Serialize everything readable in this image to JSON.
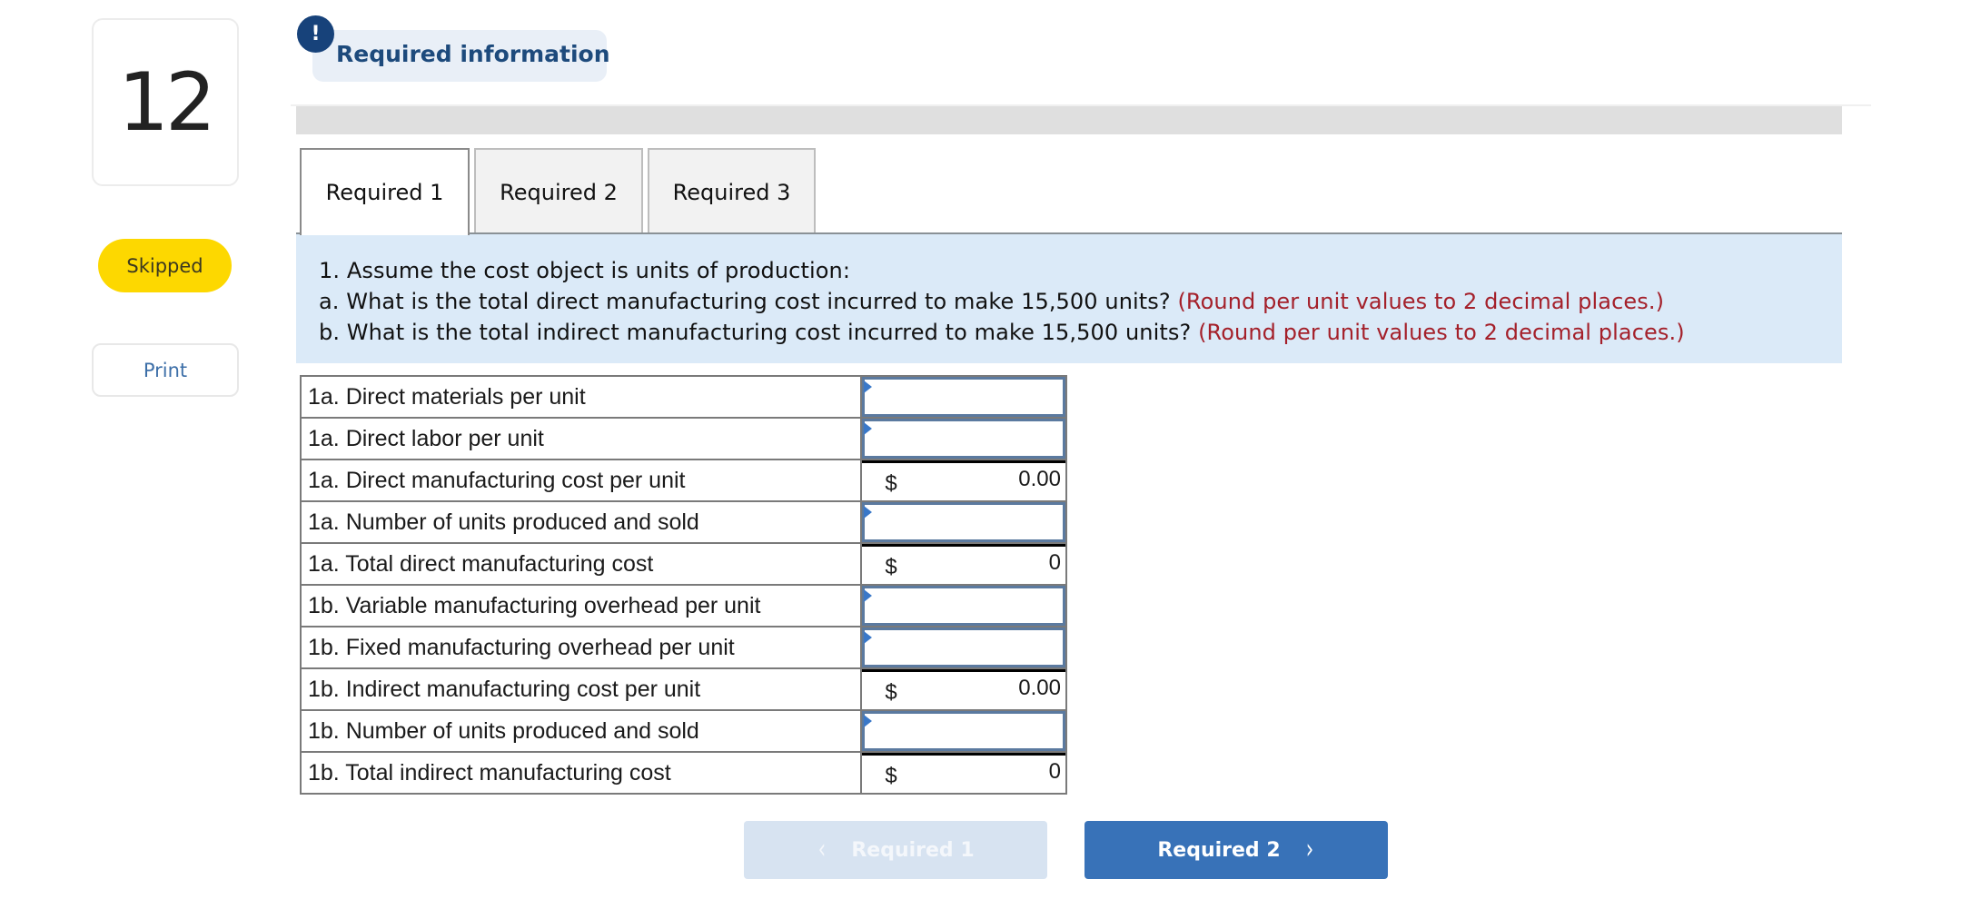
{
  "question": {
    "number": "12",
    "status": "Skipped",
    "print_label": "Print",
    "status_color": "#fdd800"
  },
  "header": {
    "alert_icon": "!",
    "title": "Required information"
  },
  "tabs": [
    {
      "label": "Required 1",
      "active": true
    },
    {
      "label": "Required 2",
      "active": false
    },
    {
      "label": "Required 3",
      "active": false
    }
  ],
  "prompt": {
    "line1": "1. Assume the cost object is units of production:",
    "line2": "a. What is the total direct manufacturing cost incurred to make 15,500 units?",
    "line2_note": "(Round per unit values to 2 decimal places.)",
    "line3": "b. What is the total indirect manufacturing cost incurred to make 15,500 units?",
    "line3_note": "(Round per unit values to 2 decimal places.)",
    "note_color": "#a4202a"
  },
  "worksheet": {
    "rows": [
      {
        "label": "1a. Direct materials per unit",
        "type": "input",
        "value": ""
      },
      {
        "label": "1a. Direct labor per unit",
        "type": "input",
        "value": ""
      },
      {
        "label": "1a. Direct manufacturing cost per unit",
        "type": "calc",
        "currency": "$",
        "value": "0.00"
      },
      {
        "label": "1a. Number of units produced and sold",
        "type": "input",
        "value": ""
      },
      {
        "label": "1a. Total direct manufacturing cost",
        "type": "calc",
        "currency": "$",
        "value": "0"
      },
      {
        "label": "1b. Variable manufacturing overhead per unit",
        "type": "input",
        "value": ""
      },
      {
        "label": "1b. Fixed manufacturing overhead per unit",
        "type": "input",
        "value": ""
      },
      {
        "label": "1b. Indirect manufacturing cost per unit",
        "type": "calc",
        "currency": "$",
        "value": "0.00"
      },
      {
        "label": "1b. Number of units produced and sold",
        "type": "input",
        "value": ""
      },
      {
        "label": "1b. Total indirect manufacturing cost",
        "type": "calc",
        "currency": "$",
        "value": "0"
      }
    ]
  },
  "navigation": {
    "prev_label": "Required 1",
    "prev_icon": "‹",
    "prev_enabled": false,
    "next_label": "Required 2",
    "next_icon": "›",
    "next_enabled": true,
    "accent": "#3872b8"
  }
}
